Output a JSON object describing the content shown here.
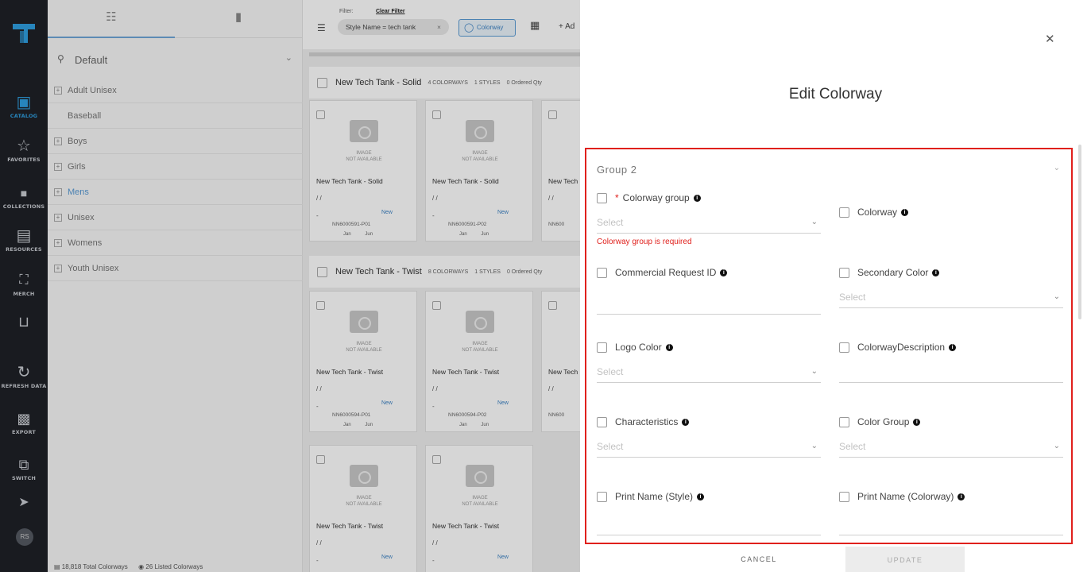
{
  "rail": {
    "items": [
      {
        "label": "CATALOG",
        "icon": "catalog-icon"
      },
      {
        "label": "FAVORITES",
        "icon": "star-icon"
      },
      {
        "label": "COLLECTIONS",
        "icon": "folder-icon"
      },
      {
        "label": "RESOURCES",
        "icon": "stack-icon"
      },
      {
        "label": "MERCH",
        "icon": "merch-icon"
      },
      {
        "label": "",
        "icon": "bed-icon"
      },
      {
        "label": "REFRESH DATA",
        "icon": "refresh-icon"
      },
      {
        "label": "EXPORT",
        "icon": "export-icon"
      },
      {
        "label": "SWITCH",
        "icon": "switch-icon"
      },
      {
        "label": "",
        "icon": "rocket-icon"
      }
    ],
    "avatar": "RS",
    "accent": "#2f9fe0"
  },
  "categories": {
    "search_value": "Default",
    "items": [
      {
        "label": "Adult Unisex",
        "expandable": true
      },
      {
        "label": "Baseball",
        "expandable": false
      },
      {
        "label": "Boys",
        "expandable": true
      },
      {
        "label": "Girls",
        "expandable": true
      },
      {
        "label": "Mens",
        "expandable": true
      },
      {
        "label": "Unisex",
        "expandable": true
      },
      {
        "label": "Womens",
        "expandable": true
      },
      {
        "label": "Youth Unisex",
        "expandable": true
      }
    ]
  },
  "toolbar": {
    "filter_label": "Filter:",
    "clear_filter": "Clear Filter",
    "chip": "Style Name = tech tank",
    "colorway_button": "Colorway",
    "add_label": "+ Ad"
  },
  "groups": [
    {
      "name": "New Tech Tank - Solid",
      "colorways": "4 COLORWAYS",
      "styles": "1 STYLES",
      "ordered": "0 Ordered Qty"
    },
    {
      "name": "New Tech Tank - Twist",
      "colorways": "8 COLORWAYS",
      "styles": "1 STYLES",
      "ordered": "0 Ordered Qty"
    }
  ],
  "cards": {
    "image_na_line1": "IMAGE",
    "image_na_line2": "NOT AVAILABLE",
    "slashes": "/ /",
    "dash": "-",
    "badge": "New",
    "jan": "Jan",
    "jun": "Jun",
    "c1": {
      "name": "New Tech Tank - Solid",
      "code": "NN6000591-P01"
    },
    "c2": {
      "name": "New Tech Tank - Solid",
      "code": "NN6000591-P02"
    },
    "c3": {
      "name": "New Tech",
      "code": "NN600"
    },
    "c4": {
      "name": "New Tech Tank - Twist",
      "code": "NN6000594-P01"
    },
    "c5": {
      "name": "New Tech Tank - Twist",
      "code": "NN6000594-P02"
    },
    "c6": {
      "name": "New Tech",
      "code": "NN600"
    },
    "c7": {
      "name": "New Tech Tank - Twist"
    },
    "c8": {
      "name": "New Tech Tank - Twist"
    }
  },
  "footer": {
    "total": "18,818 Total Colorways",
    "listed": "26 Listed Colorways"
  },
  "drawer": {
    "title": "Edit Colorway",
    "group_label": "Group 2",
    "select_placeholder": "Select",
    "fields": {
      "colorway_group": "Colorway group",
      "colorway_group_error": "Colorway group is required",
      "colorway": "Colorway",
      "commercial_request_id": "Commercial Request ID",
      "secondary_color": "Secondary Color",
      "logo_color": "Logo Color",
      "colorway_description": "ColorwayDescription",
      "characteristics": "Characteristics",
      "color_group": "Color Group",
      "print_name_style": "Print Name (Style)",
      "print_name_colorway": "Print Name (Colorway)"
    },
    "cancel": "CANCEL",
    "update": "UPDATE",
    "highlight_color": "#e0201c"
  }
}
